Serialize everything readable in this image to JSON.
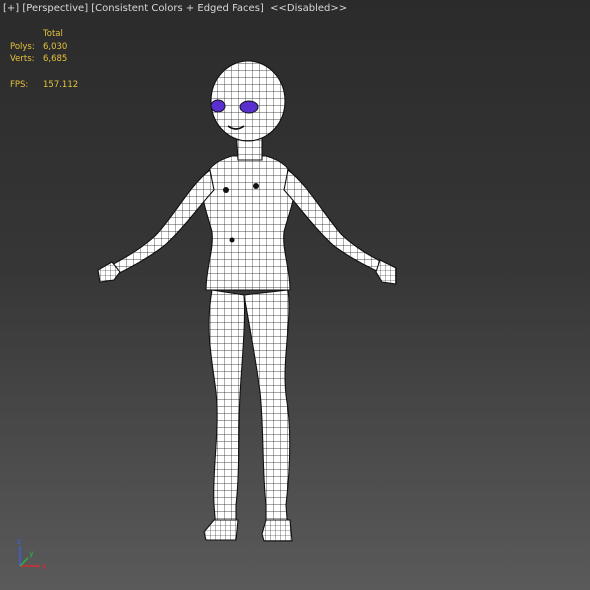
{
  "viewport": {
    "label_plus": "[+]",
    "label_view": "[Perspective]",
    "label_shading": "[Consistent Colors + Edged Faces]",
    "label_disabled": "<<Disabled>>"
  },
  "stats": {
    "header": "Total",
    "polys_label": "Polys:",
    "polys_value": "6,030",
    "verts_label": "Verts:",
    "verts_value": "6,685",
    "fps_label": "FPS:",
    "fps_value": "157.112"
  },
  "colors": {
    "background_top": "#2b2b2b",
    "background_bottom": "#5a5a5a",
    "stats_text": "#e6c23c",
    "mesh_fill": "#ffffff",
    "mesh_edge": "#111111",
    "eye": "#5a2fd0"
  },
  "axis_gizmo": {
    "x": "x",
    "y": "y",
    "z": "z",
    "x_color": "#d23030",
    "y_color": "#2fb24a",
    "z_color": "#3a5ee0"
  }
}
